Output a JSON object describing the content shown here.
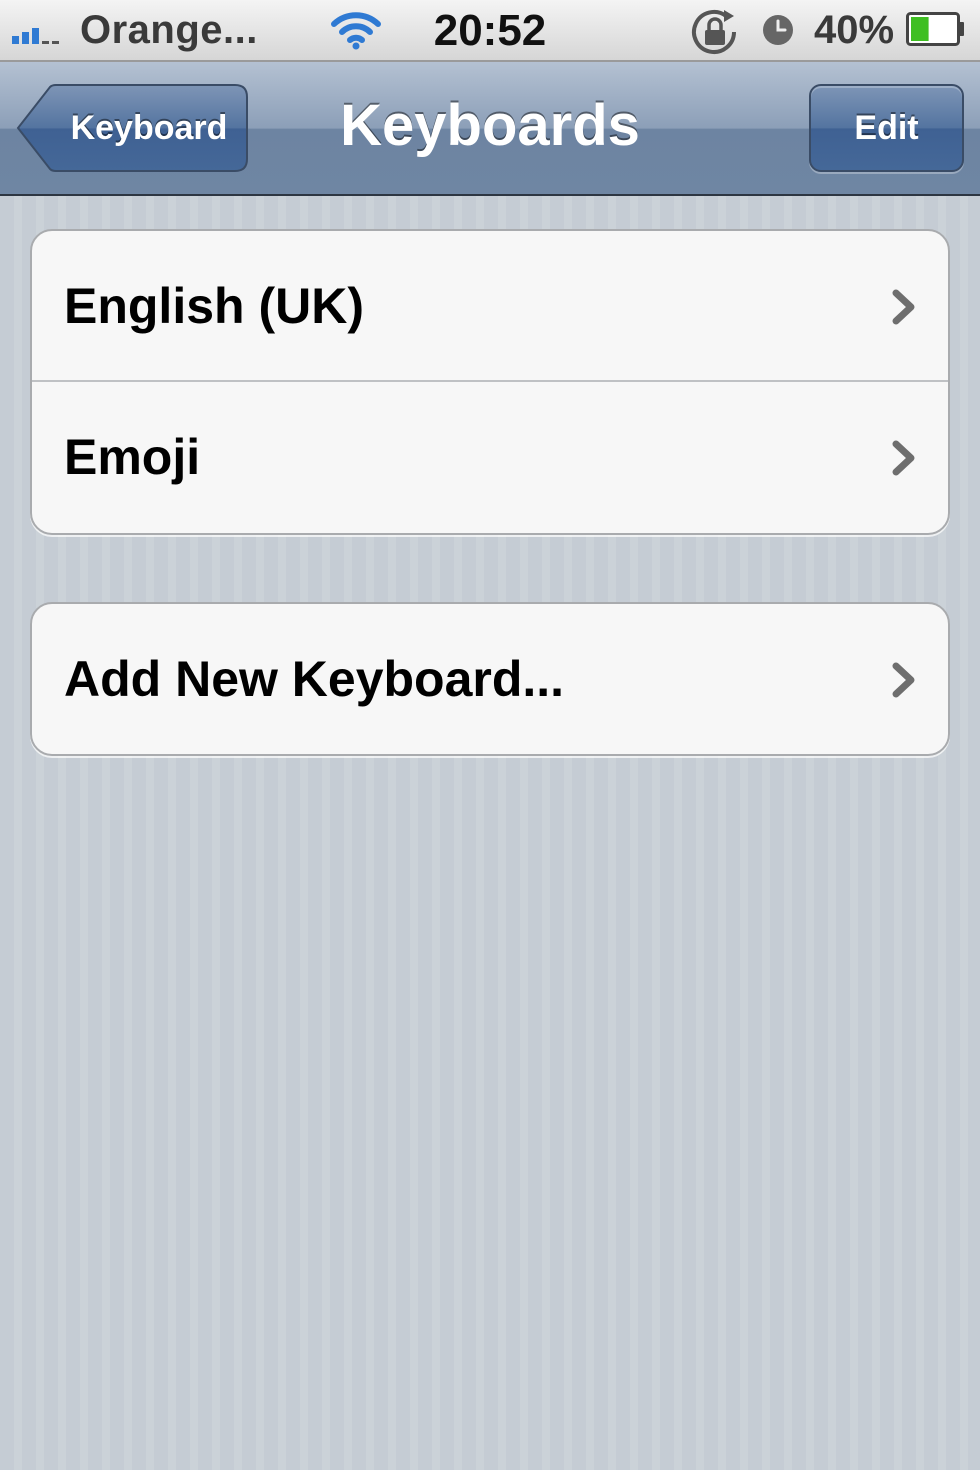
{
  "status_bar": {
    "carrier": "Orange...",
    "time": "20:52",
    "battery_percent": "40%",
    "battery_level": 0.4,
    "signal_bars_active": 3,
    "signal_bars_total": 5,
    "icons": [
      "signal-icon",
      "wifi-icon",
      "rotation-lock-icon",
      "alarm-clock-icon",
      "battery-icon"
    ]
  },
  "nav": {
    "back_label": "Keyboard",
    "title": "Keyboards",
    "edit_label": "Edit"
  },
  "keyboards": [
    {
      "label": "English (UK)"
    },
    {
      "label": "Emoji"
    }
  ],
  "add_keyboard": {
    "label": "Add New Keyboard..."
  },
  "colors": {
    "nav_bar": "#6d84a2",
    "edit_button": "#456898",
    "background": "#c5ccd4",
    "cell_background": "#f7f7f7",
    "signal_active": "#2f7ad3",
    "battery_fill": "#3fbf22"
  }
}
